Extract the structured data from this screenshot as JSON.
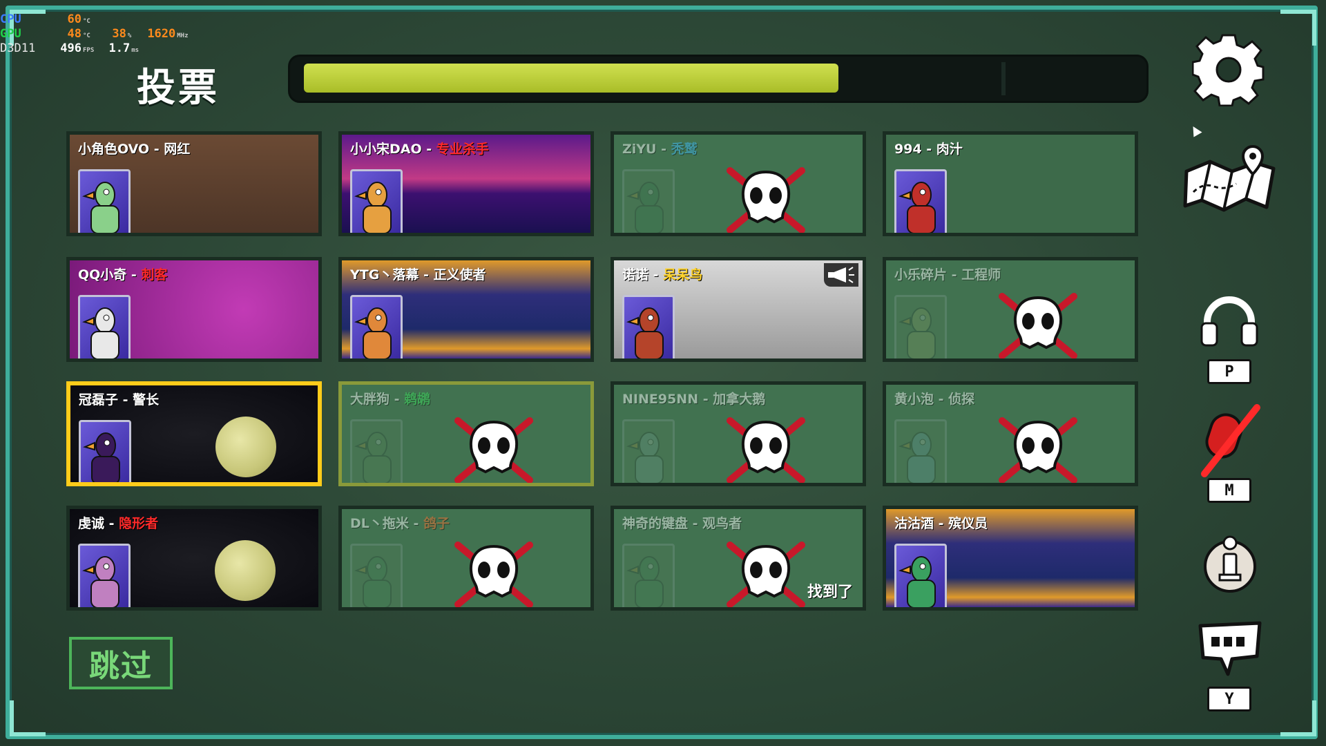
{
  "hud": {
    "cpu_label": "CPU",
    "cpu_temp": "60",
    "cpu_temp_unit": "°C",
    "gpu_label": "GPU",
    "gpu_temp": "48",
    "gpu_temp_unit": "°C",
    "gpu_load": "38",
    "gpu_load_unit": "%",
    "gpu_clock": "1620",
    "gpu_clock_unit": "MHz",
    "api_label": "D3D11",
    "fps": "496",
    "fps_unit": "FPS",
    "frametime": "1.7",
    "frametime_unit": "ms"
  },
  "title": "投票",
  "timer": {
    "progress": 0.645
  },
  "skip_label": "跳过",
  "players": [
    {
      "name": "小角色OVO",
      "sep": " - ",
      "role": "网红",
      "role_color": "#ffffff",
      "dead": false,
      "bg": "wood",
      "selected": false
    },
    {
      "name": "小小宋DAO",
      "sep": " - ",
      "role": "专业杀手",
      "role_color": "#ff2a2a",
      "dead": false,
      "bg": "synth",
      "selected": false
    },
    {
      "name": "ZiYU",
      "sep": " - ",
      "role": "秃鹫",
      "role_color": "#3ab8ff",
      "dead": true,
      "bg": "dead",
      "selected": false
    },
    {
      "name": "994",
      "sep": " - ",
      "role": "肉汁",
      "role_color": "#ffffff",
      "dead": false,
      "bg": "dead-green",
      "selected": false
    },
    {
      "name": "QQ小奇",
      "sep": " - ",
      "role": "刺客",
      "role_color": "#ff2a2a",
      "dead": false,
      "bg": "hearts",
      "selected": false
    },
    {
      "name": "YTG丶落幕",
      "sep": " - ",
      "role": "正义使者",
      "role_color": "#ffffff",
      "dead": false,
      "bg": "space",
      "selected": false
    },
    {
      "name": "诺诺",
      "sep": " - ",
      "role": "呆呆鸟",
      "role_color": "#ffd32a",
      "dead": false,
      "bg": "star",
      "selected": false,
      "speaking": true
    },
    {
      "name": "小乐碎片",
      "sep": " - ",
      "role": "工程师",
      "role_color": "#ffffff",
      "dead": true,
      "bg": "dead",
      "selected": false
    },
    {
      "name": "冠磊子",
      "sep": " - ",
      "role": "警长",
      "role_color": "#ffffff",
      "dead": false,
      "bg": "moon",
      "selected": true
    },
    {
      "name": "大胖狗",
      "sep": " - ",
      "role": "鹈鹕",
      "role_color": "#38e05a",
      "dead": true,
      "bg": "dead",
      "selected": false,
      "highlight": true
    },
    {
      "name": "NINE95NN",
      "sep": " - ",
      "role": "加拿大鹅",
      "role_color": "#ffffff",
      "dead": true,
      "bg": "dead",
      "selected": false
    },
    {
      "name": "黄小泡",
      "sep": " - ",
      "role": "侦探",
      "role_color": "#ffffff",
      "dead": true,
      "bg": "dead",
      "selected": false
    },
    {
      "name": "虔诚",
      "sep": " - ",
      "role": "隐形者",
      "role_color": "#ff2a2a",
      "dead": false,
      "bg": "moon",
      "selected": false
    },
    {
      "name": "DL丶拖米",
      "sep": " - ",
      "role": "鸽子",
      "role_color": "#ff6a2a",
      "dead": true,
      "bg": "dead",
      "selected": false
    },
    {
      "name": "神奇的键盘",
      "sep": " - ",
      "role": "观鸟者",
      "role_color": "#ffffff",
      "dead": true,
      "bg": "dead",
      "selected": false,
      "found": "找到了"
    },
    {
      "name": "沽沽酒",
      "sep": " - ",
      "role": "殡仪员",
      "role_color": "#ffffff",
      "dead": false,
      "bg": "space",
      "selected": false
    }
  ],
  "side_buttons": {
    "settings": "gear-icon",
    "map": "map-icon",
    "voice": "headphones-icon",
    "voice_key": "P",
    "mic": "mic-muted-icon",
    "mic_key": "M",
    "info": "info-icon",
    "chat": "chat-icon",
    "chat_key": "Y"
  },
  "colors": {
    "frame": "#3fae9b",
    "timer_fill": "#c4d43c",
    "selected_border": "#ffcc1a",
    "dead_overlay": "#46785a",
    "skip": "#79d879"
  }
}
